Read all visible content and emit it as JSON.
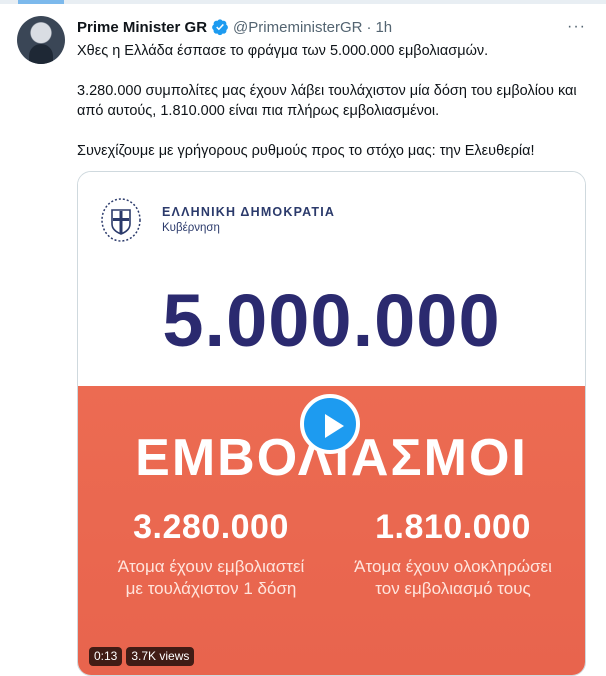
{
  "tweet": {
    "author_name": "Prime Minister GR",
    "handle": "@PrimeministerGR",
    "separator": "·",
    "time": "1h",
    "more_label": "···",
    "paragraphs": [
      "Χθες η Ελλάδα έσπασε το φράγμα των 5.000.000 εμβολιασμών.",
      "3.280.000 συμπολίτες μας έχουν λάβει τουλάχιστον μία δόση του εμβολίου και από αυτούς, 1.810.000 είναι πια πλήρως εμβολιασμένοι.",
      "Συνεχίζουμε με γρήγορους ρυθμούς προς το στόχο μας: την Ελευθερία!"
    ]
  },
  "media": {
    "gov_title": "ΕΛΛΗΝΙΚΗ ΔΗΜΟΚΡΑΤΙΑ",
    "gov_subtitle": "Κυβέρνηση",
    "big_number": "5.000.000",
    "headline": "ΕΜΒΟΛΙΑΣΜΟΙ",
    "stats": [
      {
        "number": "3.280.000",
        "caption_line1": "Άτομα έχουν εμβολιαστεί",
        "caption_line2": "με τουλάχιστον 1 δόση"
      },
      {
        "number": "1.810.000",
        "caption_line1": "Άτομα έχουν ολοκληρώσει",
        "caption_line2": "τον εμβολιασμό τους"
      }
    ],
    "duration": "0:13",
    "views": "3.7K views"
  },
  "colors": {
    "verified": "#1d9bf0",
    "play_button": "#1d9bf0",
    "card_orange": "#ec6b52",
    "number_navy": "#2b2a6f"
  },
  "icons": [
    "verified-badge-icon",
    "more-icon",
    "greek-emblem-icon",
    "play-icon"
  ]
}
